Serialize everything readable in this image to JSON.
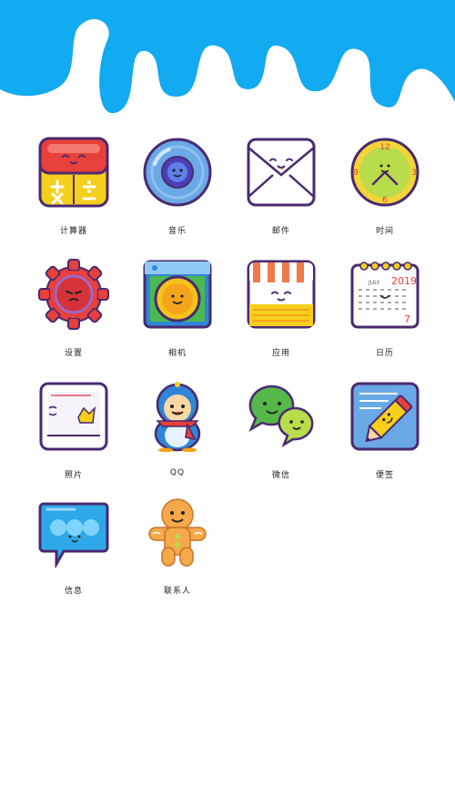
{
  "apps": [
    {
      "id": "calculator",
      "label": "计算器"
    },
    {
      "id": "music",
      "label": "音乐"
    },
    {
      "id": "mail",
      "label": "邮件"
    },
    {
      "id": "clock",
      "label": "时间"
    },
    {
      "id": "settings",
      "label": "设置"
    },
    {
      "id": "camera",
      "label": "相机"
    },
    {
      "id": "store",
      "label": "应用"
    },
    {
      "id": "calendar",
      "label": "日历"
    },
    {
      "id": "photos",
      "label": "照片"
    },
    {
      "id": "qq",
      "label": "QQ"
    },
    {
      "id": "wechat",
      "label": "微信"
    },
    {
      "id": "notes",
      "label": "便签"
    },
    {
      "id": "messages",
      "label": "信息"
    },
    {
      "id": "contacts",
      "label": "联系人"
    }
  ],
  "clock": {
    "n12": "12",
    "n3": "3",
    "n6": "6",
    "n9": "9"
  },
  "calendar": {
    "month": "JULY",
    "year": "2019",
    "day": "7"
  },
  "colors": {
    "sky": "#12aaf0",
    "outline": "#4a2a70",
    "red": "#e8403a",
    "yellow": "#f5cf1b"
  }
}
